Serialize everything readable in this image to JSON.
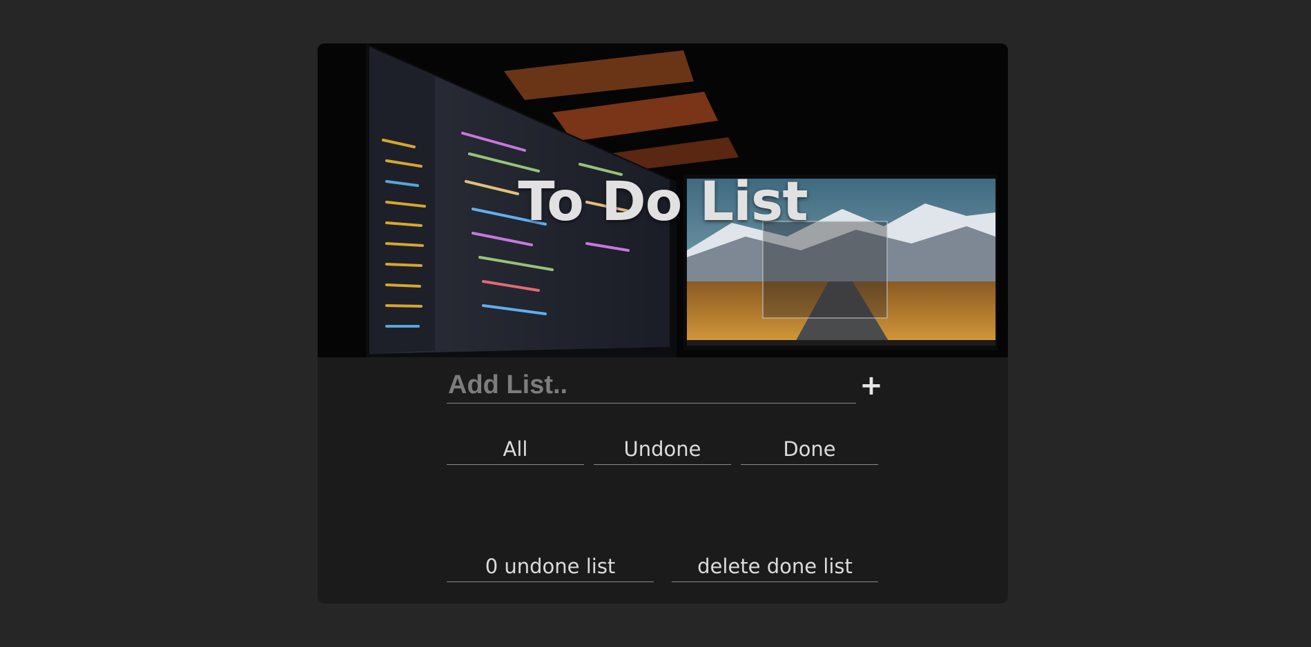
{
  "header": {
    "title": "To Do List",
    "image_description": "dark photo of two monitors with code editor and mountain wallpaper"
  },
  "add_form": {
    "placeholder": "Add List..",
    "value": "",
    "add_button_label": "+"
  },
  "filters": [
    {
      "label": "All"
    },
    {
      "label": "Undone"
    },
    {
      "label": "Done"
    }
  ],
  "footer": {
    "undone_count_text": "0 undone list",
    "delete_done_label": "delete done list"
  },
  "colors": {
    "page_bg": "#262626",
    "card_bg": "#1b1b1b",
    "text": "#dcdcdc",
    "underline": "#8a8a8a",
    "placeholder": "#7d7d7d"
  }
}
